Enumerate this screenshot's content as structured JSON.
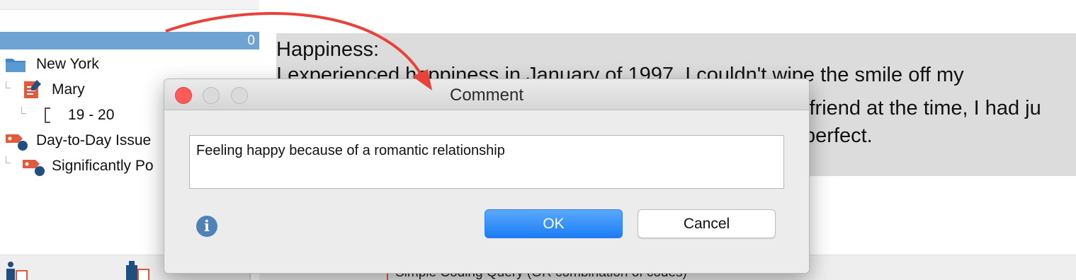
{
  "tree": {
    "header_count": "0",
    "items": [
      {
        "label": "New York",
        "icon": "folder-icon"
      },
      {
        "label": "Mary",
        "icon": "document-edit-icon"
      },
      {
        "label": "19 - 20",
        "icon": "bracket-segment-icon"
      },
      {
        "label": "Day-to-Day Issue",
        "icon": "code-tag-icon"
      },
      {
        "label": "Significantly Po",
        "icon": "code-tag-icon"
      }
    ]
  },
  "document": {
    "heading": "Happiness:",
    "line1": "I experienced happiness in January of 1997. I couldn't wipe the smile off my",
    "line2": "yfriend at the time, I had ju",
    "line3": "perfect.",
    "bottom_text": "Simple Coding Query (OR combination of codes)"
  },
  "dialog": {
    "title": "Comment",
    "comment_value": "Feeling happy because of a romantic relationship",
    "ok_label": "OK",
    "cancel_label": "Cancel",
    "info_glyph": "i"
  },
  "colors": {
    "accent": "#1b7df6",
    "tree_header": "#6fa3d4",
    "arrow": "#e8433a",
    "close_button": "#fc5b57"
  }
}
